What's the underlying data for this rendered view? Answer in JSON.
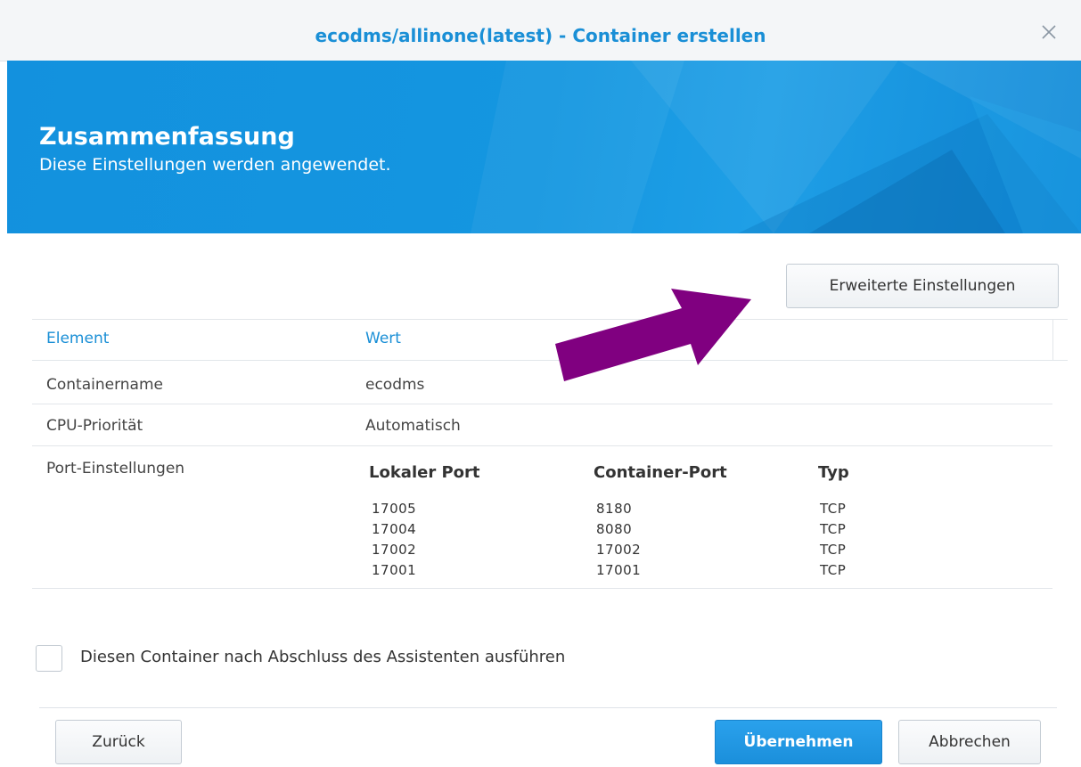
{
  "window": {
    "title": "ecodms/allinone(latest) - Container erstellen",
    "close_icon": "close-icon"
  },
  "banner": {
    "heading": "Zusammenfassung",
    "subtitle": "Diese Einstellungen werden angewendet."
  },
  "advanced_button": "Erweiterte Einstellungen",
  "table": {
    "headers": [
      "Element",
      "Wert"
    ],
    "rows": [
      {
        "element": "Containername",
        "value": "ecodms"
      },
      {
        "element": "CPU-Priorität",
        "value": "Automatisch"
      },
      {
        "element": "Port-Einstellungen",
        "value": ""
      }
    ],
    "ports": {
      "headers": [
        "Lokaler Port",
        "Container-Port",
        "Typ"
      ],
      "rows": [
        [
          "17005",
          "8180",
          "TCP"
        ],
        [
          "17004",
          "8080",
          "TCP"
        ],
        [
          "17002",
          "17002",
          "TCP"
        ],
        [
          "17001",
          "17001",
          "TCP"
        ]
      ]
    }
  },
  "checkbox_label": "Diesen Container nach Abschluss des Assistenten ausführen",
  "buttons": {
    "back": "Zurück",
    "apply": "Übernehmen",
    "cancel": "Abbrechen"
  },
  "colors": {
    "accent": "#1a8fd6",
    "banner": "#1496e0",
    "arrow": "#800080"
  }
}
